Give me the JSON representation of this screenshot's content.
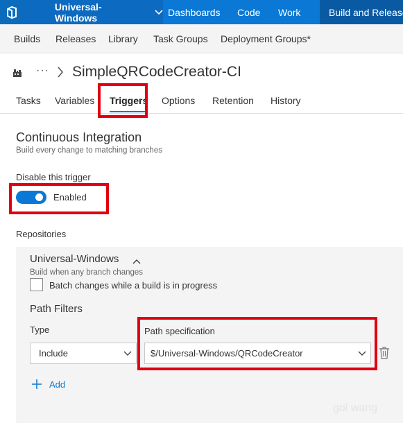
{
  "topnav": {
    "logo_icon": "vsts-logo-icon",
    "project": "Universal-Windows",
    "links": [
      "Dashboards",
      "Code",
      "Work",
      "Build and Release"
    ],
    "active_link": "Build and Release",
    "accent_color": "#0a78d4"
  },
  "subnav": {
    "items": [
      "Builds",
      "Releases",
      "Library",
      "Task Groups",
      "Deployment Groups*"
    ]
  },
  "breadcrumb": {
    "icon": "build-definition-icon",
    "ellipsis": "···",
    "title": "SimpleQRCodeCreator-CI"
  },
  "tabs": {
    "items": [
      "Tasks",
      "Variables",
      "Triggers",
      "Options",
      "Retention",
      "History"
    ],
    "active": "Triggers"
  },
  "ci": {
    "title": "Continuous Integration",
    "subtitle": "Build every change to matching branches",
    "disable_label": "Disable this trigger",
    "toggle_state": "Enabled",
    "toggle_on": true
  },
  "repositories": {
    "label": "Repositories",
    "repo_name": "Universal-Windows",
    "repo_subtitle": "Build when any branch changes",
    "batch_label": "Batch changes while a build is in progress",
    "batch_checked": false
  },
  "path_filters": {
    "title": "Path Filters",
    "type_label": "Type",
    "type_value": "Include",
    "path_label": "Path specification",
    "path_value": "$/Universal-Windows/QRCodeCreator",
    "add_label": "Add"
  },
  "highlight_color": "#e00010",
  "watermark": "gol wang"
}
